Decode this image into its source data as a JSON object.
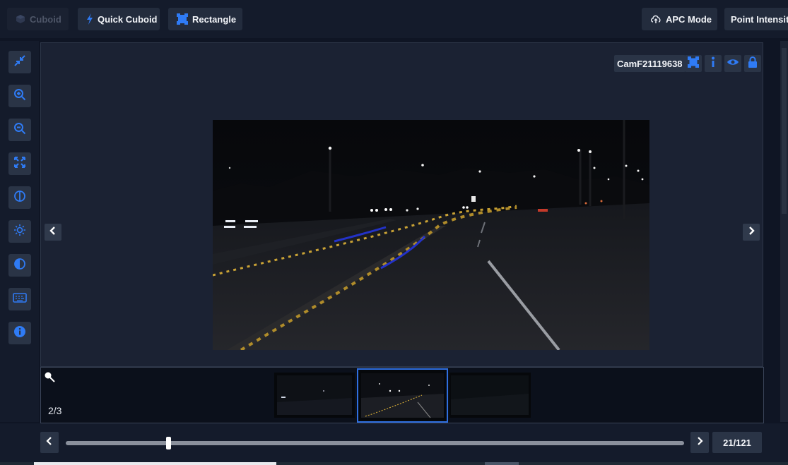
{
  "toolbar": {
    "cuboid_label": "Cuboid",
    "quick_cuboid_label": "Quick Cuboid",
    "rectangle_label": "Rectangle",
    "apc_mode_label": "APC Mode",
    "point_intensity_label": "Point Intensity"
  },
  "left_tools": [
    {
      "icon": "compress-icon"
    },
    {
      "icon": "zoom-in-icon"
    },
    {
      "icon": "zoom-out-icon"
    },
    {
      "icon": "fit-screen-icon"
    },
    {
      "icon": "half-circle-icon"
    },
    {
      "icon": "brightness-icon"
    },
    {
      "icon": "contrast-icon"
    },
    {
      "icon": "keyboard-icon"
    },
    {
      "icon": "info-icon"
    }
  ],
  "viewer": {
    "camera_name": "CamF21119638",
    "camera_icons": [
      "bounding-box-icon",
      "info-icon",
      "eye-icon",
      "lock-icon"
    ]
  },
  "filmstrip": {
    "counter": "2/3",
    "active_index": 1
  },
  "timeline": {
    "frame_label": "21/121",
    "progress": 0.166
  },
  "colors": {
    "accent": "#2f7bf5",
    "background": "#0f1524",
    "panel": "#141b2b",
    "lane_yellow": "#c9a235",
    "lane_blue": "#2332c8"
  }
}
